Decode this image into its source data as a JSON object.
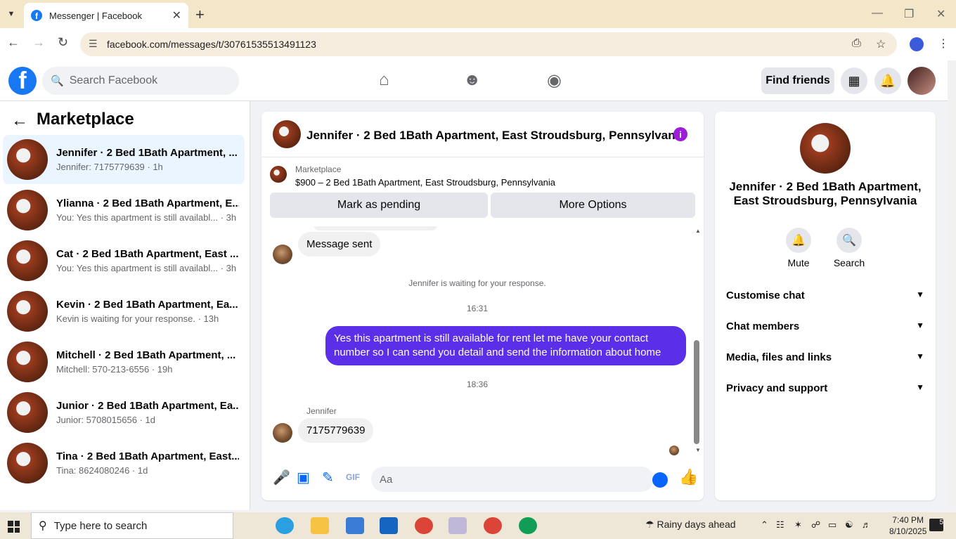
{
  "browser": {
    "tab_title": "Messenger | Facebook",
    "url": "facebook.com/messages/t/30761535513491123"
  },
  "fb_header": {
    "search_placeholder": "Search Facebook",
    "find_friends": "Find friends"
  },
  "sidebar": {
    "title": "Marketplace",
    "conversations": [
      {
        "name": "Jennifer · 2 Bed 1Bath Apartment, ...",
        "sub": "Jennifer: 7175779639 · 1h"
      },
      {
        "name": "Ylianna · 2 Bed 1Bath Apartment, E...",
        "sub": "You: Yes this apartment is still availabl... · 3h"
      },
      {
        "name": "Cat · 2 Bed 1Bath Apartment, East ...",
        "sub": "You: Yes this apartment is still availabl... · 3h"
      },
      {
        "name": "Kevin · 2 Bed 1Bath Apartment, Ea...",
        "sub": "Kevin is waiting for your response. · 13h"
      },
      {
        "name": "Mitchell · 2 Bed 1Bath Apartment, ...",
        "sub": "Mitchell: 570-213-6556 · 19h"
      },
      {
        "name": "Junior · 2 Bed 1Bath Apartment, Ea...",
        "sub": "Junior: 5708015656 · 1d"
      },
      {
        "name": "Tina · 2 Bed 1Bath Apartment, East...",
        "sub": "Tina: 8624080246 · 1d"
      }
    ]
  },
  "chat": {
    "title": "Jennifer · 2 Bed 1Bath Apartment, East Stroudsburg, Pennsylvania",
    "listing_label": "Marketplace",
    "listing_desc": "$900 – 2 Bed 1Bath Apartment, East Stroudsburg, Pennsylvania",
    "mark_pending": "Mark as pending",
    "more_options": "More Options",
    "msg_sent": "Message sent",
    "waiting_note": "Jennifer is waiting for your response.",
    "time1": "16:31",
    "outgoing": "Yes this apartment is still available for rent let me have your contact number so I can send you detail and send the information about home",
    "time2": "18:36",
    "sender": "Jennifer",
    "incoming": "7175779639",
    "composer_placeholder": "Aa"
  },
  "details": {
    "name": "Jennifer · 2 Bed 1Bath Apartment, East Stroudsburg, Pennsylvania",
    "mute": "Mute",
    "search": "Search",
    "sections": [
      "Customise chat",
      "Chat members",
      "Media, files and links",
      "Privacy and support"
    ]
  },
  "taskbar": {
    "search": "Type here to search",
    "weather": "Rainy days ahead",
    "time": "7:40 PM",
    "date": "8/10/2025",
    "notif_count": "5"
  },
  "colors": {
    "fb_blue": "#1877f2",
    "outgoing_bubble": "#5b2ee8",
    "info_purple": "#9b1fd6"
  }
}
